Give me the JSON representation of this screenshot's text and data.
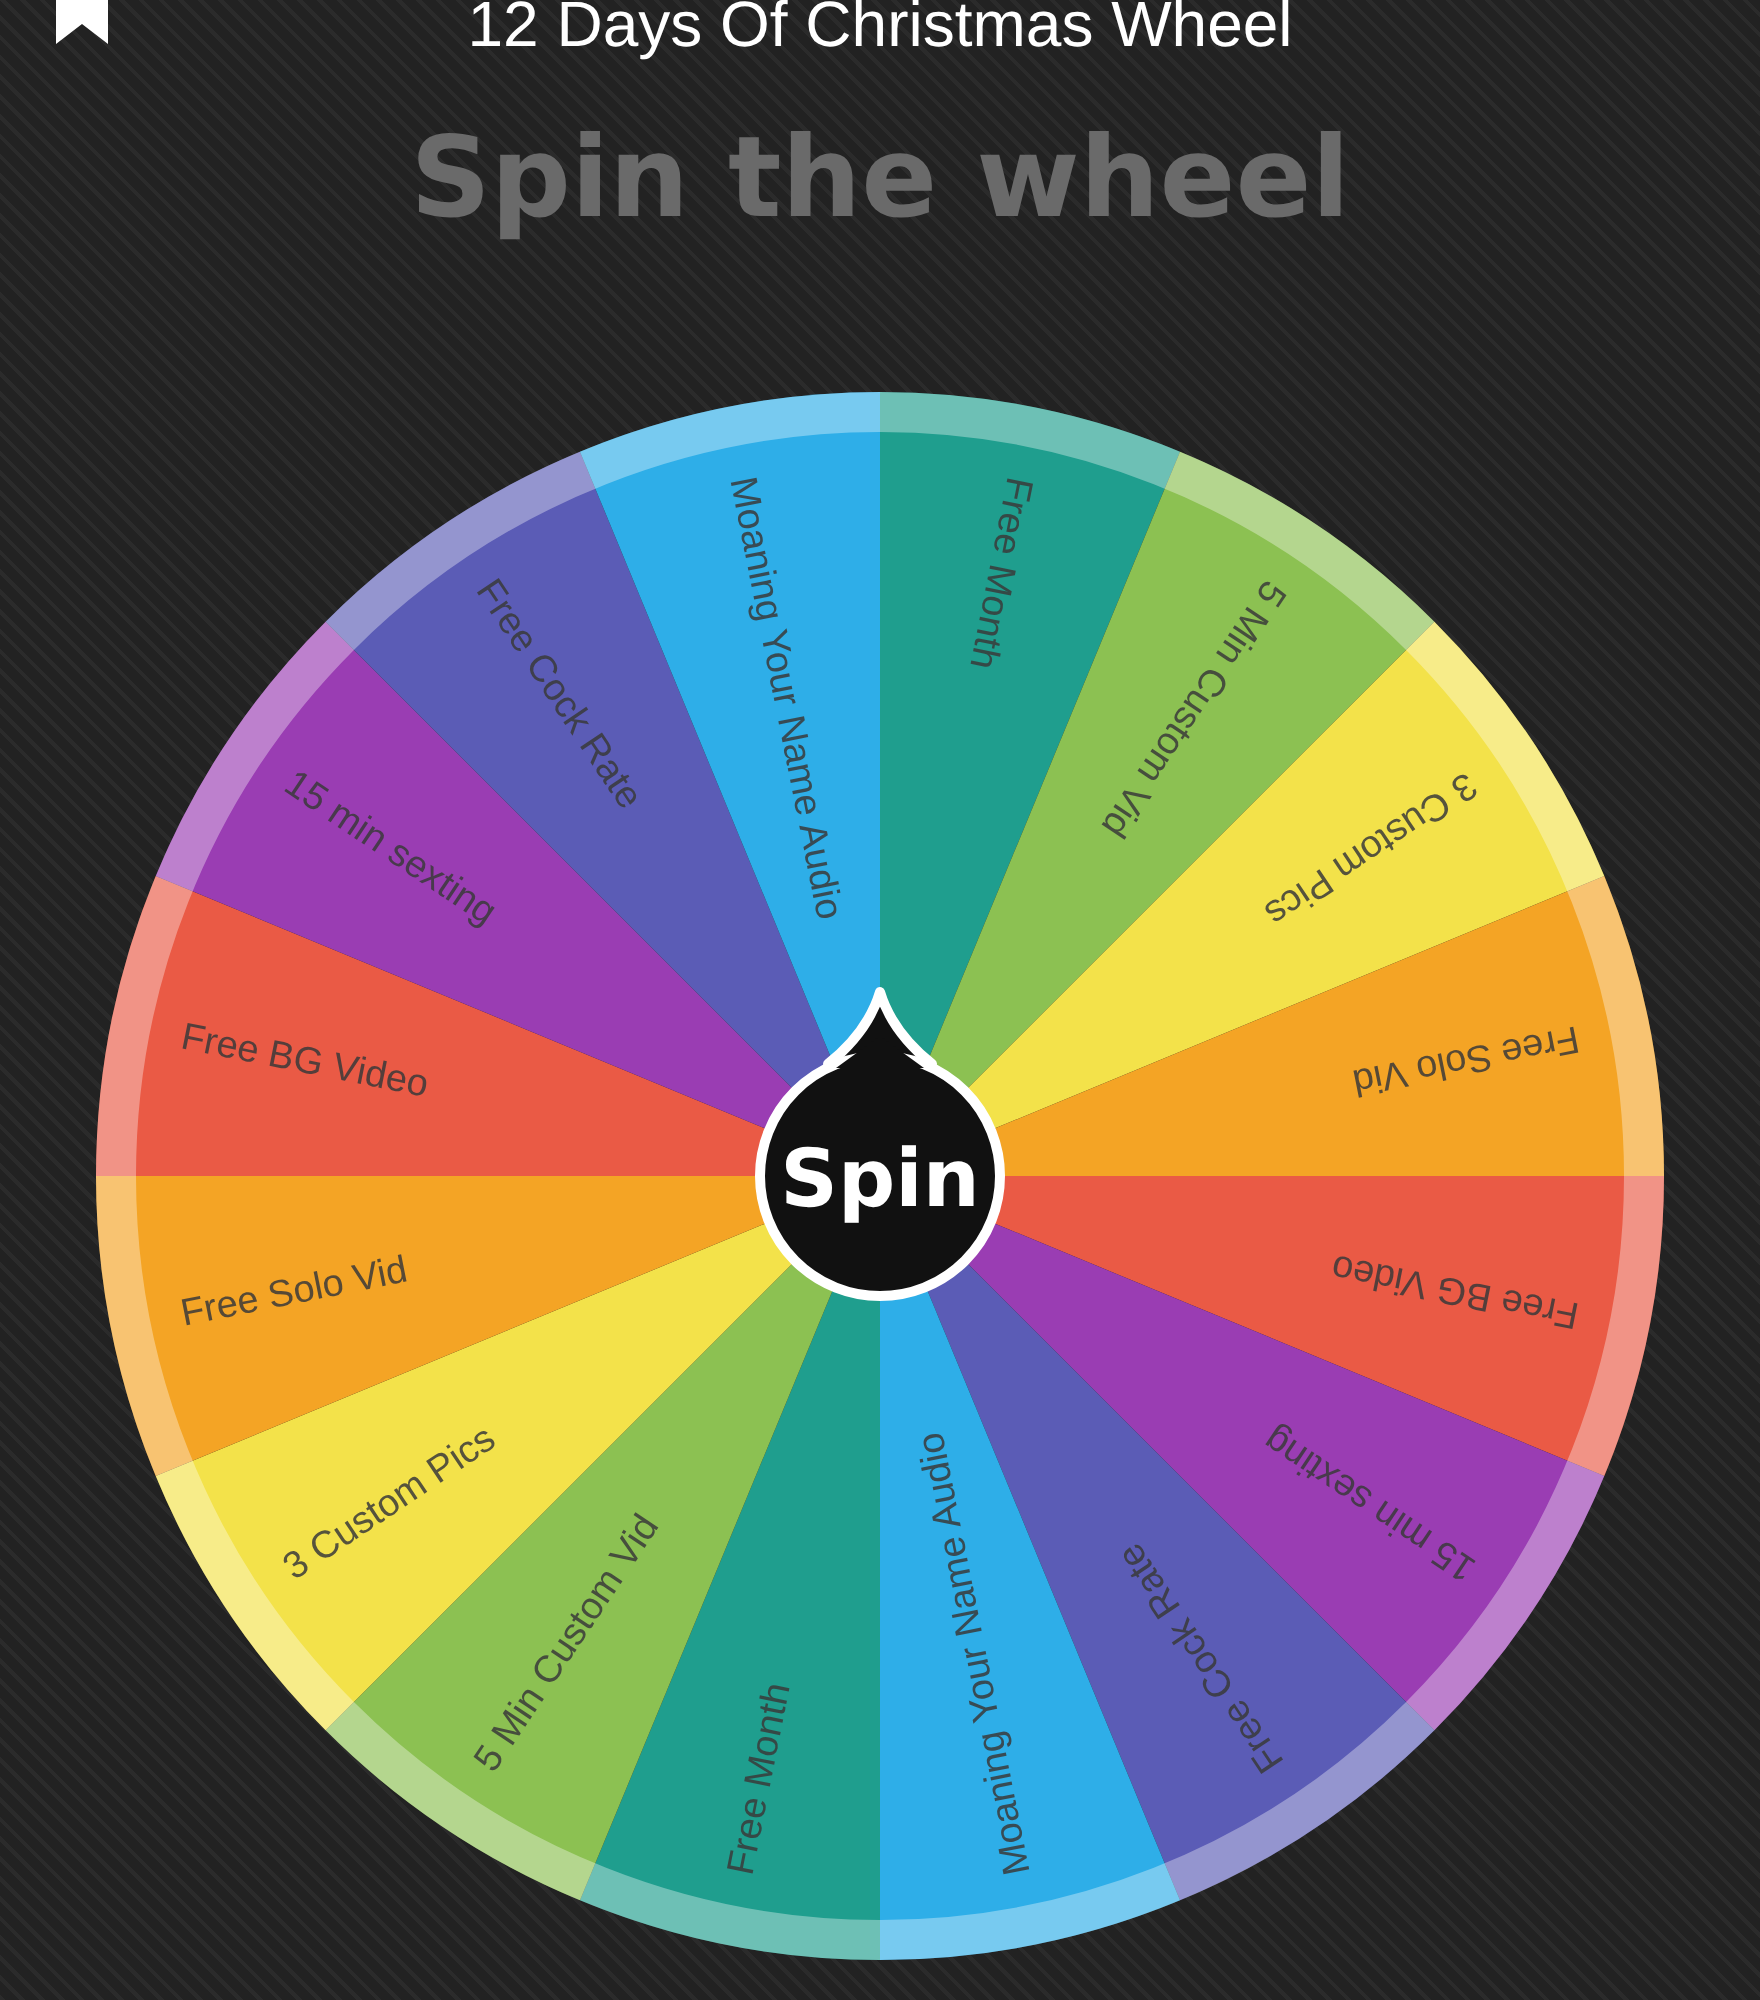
{
  "header": {
    "title": "12 Days Of Christmas Wheel"
  },
  "heading": "Spin the wheel",
  "wheel": {
    "segments": [
      {
        "label": "Free Month",
        "color": "#1f9e8e"
      },
      {
        "label": "5 Min Custom Vid",
        "color": "#8cc152"
      },
      {
        "label": "3 Custom Pics",
        "color": "#f3e24a"
      },
      {
        "label": "Free Solo Vid",
        "color": "#f4a425"
      },
      {
        "label": "Free BG Video",
        "color": "#ea5a45"
      },
      {
        "label": "15 min sexting",
        "color": "#9a3db3"
      },
      {
        "label": "Free Cock Rate",
        "color": "#5b5cb6"
      },
      {
        "label": "Moaning Your Name Audio",
        "color": "#2eaee8"
      },
      {
        "label": "Free Month",
        "color": "#1f9e8e"
      },
      {
        "label": "5 Min Custom Vid",
        "color": "#8cc152"
      },
      {
        "label": "3 Custom Pics",
        "color": "#f3e24a"
      },
      {
        "label": "Free Solo Vid",
        "color": "#f4a425"
      },
      {
        "label": "Free BG Video",
        "color": "#ea5a45"
      },
      {
        "label": "15 min sexting",
        "color": "#9a3db3"
      },
      {
        "label": "Free Cock Rate",
        "color": "#5b5cb6"
      },
      {
        "label": "Moaning Your Name Audio",
        "color": "#2eaee8"
      }
    ],
    "spin_button": "Spin"
  }
}
